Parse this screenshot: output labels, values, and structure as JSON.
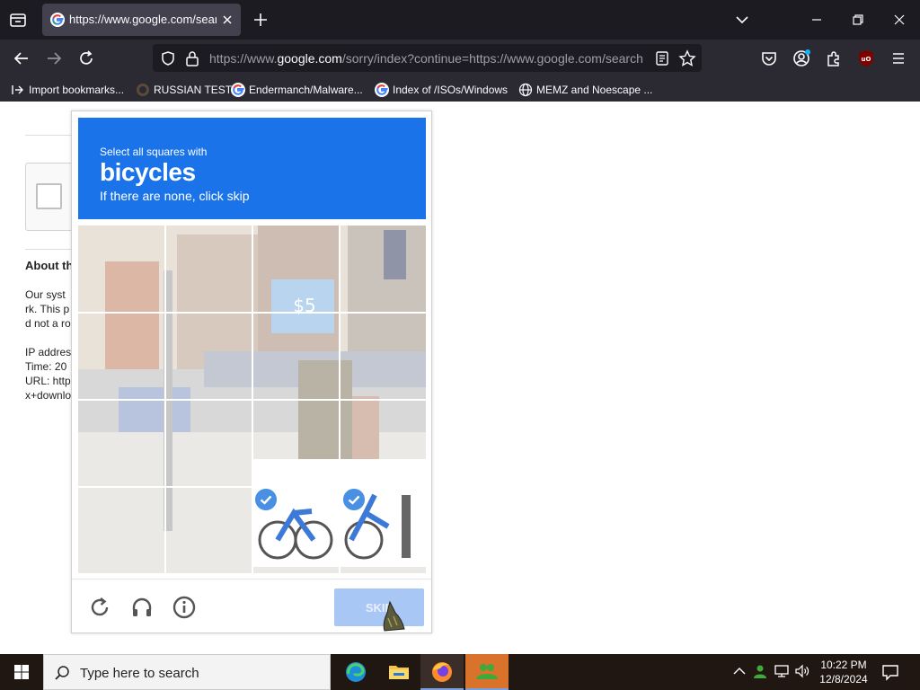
{
  "browser": {
    "tab": {
      "title": "https://www.google.com/search"
    },
    "url": {
      "prefix": "https://www.",
      "domain": "google.com",
      "rest": "/sorry/index?continue=https://www.google.com/search"
    },
    "bookmarks": [
      {
        "label": "Import bookmarks...",
        "icon": "import-icon"
      },
      {
        "label": "RUSSIAN TEST",
        "icon": "site-favicon"
      },
      {
        "label": "Endermanch/Malware...",
        "icon": "google-icon"
      },
      {
        "label": "Index of /ISOs/Windows",
        "icon": "google-icon"
      },
      {
        "label": "MEMZ and Noescape ...",
        "icon": "globe-icon"
      }
    ]
  },
  "page": {
    "about_heading": "About th",
    "lines_a": [
      "Our syst",
      "rk. This p",
      "d not a ro"
    ],
    "lines_b": [
      "IP addres",
      "Time: 20",
      "URL: http",
      "x+downlo"
    ]
  },
  "captcha": {
    "instruction_line1": "Select all squares with",
    "keyword": "bicycles",
    "instruction_line3": "If there are none, click skip",
    "skip_label": "SKIP",
    "accent_color": "#1a73e8",
    "selected_cells": [
      14,
      15
    ]
  },
  "taskbar": {
    "search_placeholder": "Type here to search",
    "time": "10:22 PM",
    "date": "12/8/2024"
  }
}
